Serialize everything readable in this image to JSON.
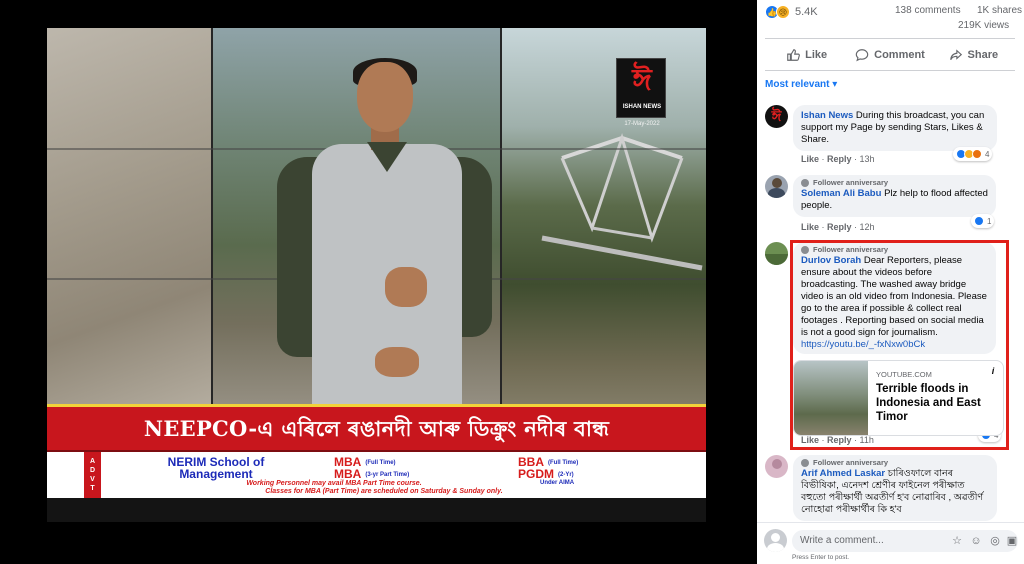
{
  "video": {
    "channel_name": "ISHAN NEWS",
    "channel_mark": "ঈ",
    "date": "17-May-2022",
    "headline": "NEEPCO-এ এৰিলে ৰঙানদী আৰু ডিক্ৰুং নদীৰ বান্ধ",
    "ad": {
      "side_label": "ADVT",
      "school_line1": "NERIM School of",
      "school_line2": "Management",
      "prog1": "MBA",
      "prog1_note": "(Full Time)",
      "prog2": "MBA",
      "prog2_note": "(3-yr Part Time)",
      "prog3": "BBA",
      "prog3_note": "(Full Time)",
      "prog4": "PGDM",
      "prog4_note": "(2-Yr)",
      "prog4_sub": "Under AIMA",
      "note1": "Working Personnel may avail MBA Part Time course.",
      "note2": "Classes for MBA (Part Time) are scheduled on Saturday & Sunday only."
    }
  },
  "post_stats": {
    "reaction_count": "5.4K",
    "comments": "138 comments",
    "shares": "1K shares",
    "views": "219K views"
  },
  "actions": {
    "like": "Like",
    "comment": "Comment",
    "share": "Share"
  },
  "sort_label": "Most relevant",
  "comments": [
    {
      "name": "Ishan News",
      "text": "During this broadcast, you can support my Page by sending Stars, Likes & Share.",
      "like": "Like",
      "reply": "Reply",
      "time": "13h",
      "react_count": "4"
    },
    {
      "badge": "Follower anniversary",
      "name": "Soleman Ali Babu",
      "text": "Plz help to flood affected people.",
      "like": "Like",
      "reply": "Reply",
      "time": "12h",
      "react_count": "1"
    },
    {
      "badge": "Follower anniversary",
      "name": "Durlov Borah",
      "text": "Dear Reporters, please ensure about the videos before broadcasting. The washed away bridge video is an old video from Indonesia. Please go to the area if possible & collect real footages . Reporting based on social media is not a good sign for journalism.",
      "url": "https://youtu.be/_-fxNxw0bCk",
      "link_domain": "YOUTUBE.COM",
      "link_title": "Terrible floods in Indonesia and East Timor",
      "link_info": "i",
      "like": "Like",
      "reply": "Reply",
      "time": "11h",
      "react_count": "4"
    },
    {
      "badge": "Follower anniversary",
      "name": "Arif Ahmed Laskar",
      "text": "চাৰিওফালে বানৰ বিভীষিকা, এনেদশ শ্ৰেণীৰ ফাইনেল পৰীক্ষাত বহুতো পৰীক্ষাৰ্থী অৱতীৰ্ণ হ'ব নোৱাৰিব , অৱতীৰ্ণ নোহোৱা পৰীক্ষাৰ্থীৰ কি হ'ব"
    }
  ],
  "composer": {
    "placeholder": "Write a comment...",
    "hint": "Press Enter to post."
  },
  "colors": {
    "brand_blue": "#1877f2",
    "headline_red": "#c8161d",
    "highlight_red": "#e0201a"
  }
}
